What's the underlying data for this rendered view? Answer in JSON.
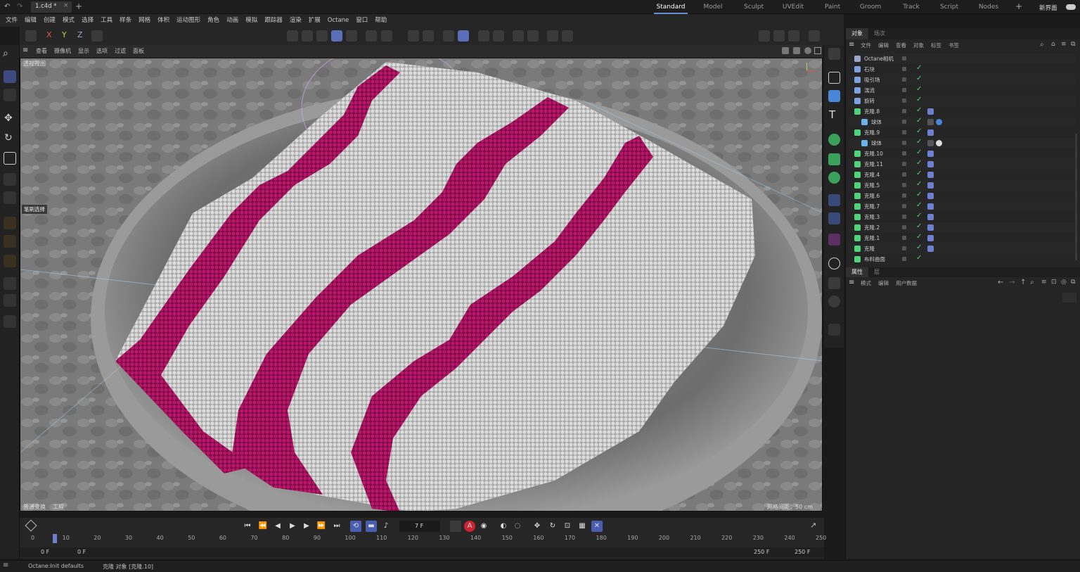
{
  "titlebar": {
    "doc_tab": "1.c4d *",
    "layouts": [
      "Standard",
      "Model",
      "Sculpt",
      "UVEdit",
      "Paint",
      "Groom",
      "Track",
      "Script",
      "Nodes"
    ],
    "active_layout": "Standard",
    "new_layout": "新界面"
  },
  "menu": [
    "文件",
    "编辑",
    "创建",
    "模式",
    "选择",
    "工具",
    "样条",
    "网格",
    "体积",
    "运动图形",
    "角色",
    "动画",
    "模拟",
    "跟踪器",
    "渲染",
    "扩展",
    "Octane",
    "窗口",
    "帮助"
  ],
  "toolbar": {
    "axis_x": "X",
    "axis_y": "Y",
    "axis_z": "Z"
  },
  "viewport": {
    "menu": [
      "查看",
      "摄像机",
      "显示",
      "选项",
      "过滤",
      "面板"
    ],
    "view_name": "透视视图",
    "tool_label": "笔刷选择",
    "transform_label": "普通变换",
    "project_label": "工程",
    "grid_spacing": "网格间距：50 cm"
  },
  "object_panel": {
    "tabs": [
      "对象",
      "场次"
    ],
    "menu": [
      "文件",
      "编辑",
      "查看",
      "对象",
      "标签",
      "书签"
    ],
    "rows": [
      {
        "name": "Octane相机",
        "indent": 0,
        "icon": "camera-icon",
        "color": "#9aa7c9"
      },
      {
        "name": "石块",
        "indent": 0,
        "icon": "figure-icon",
        "color": "#7fa1e0"
      },
      {
        "name": "吸引场",
        "indent": 0,
        "icon": "attractor-icon",
        "color": "#7fa1e0"
      },
      {
        "name": "湍流",
        "indent": 0,
        "icon": "turbulence-icon",
        "color": "#7fa1e0"
      },
      {
        "name": "旋转",
        "indent": 0,
        "icon": "rotate-icon",
        "color": "#7fa1e0"
      },
      {
        "name": "克隆.8",
        "indent": 0,
        "icon": "cloner-icon",
        "color": "#4fd27a"
      },
      {
        "name": "球体",
        "indent": 1,
        "icon": "sphere-icon",
        "color": "#6ab3ea"
      },
      {
        "name": "克隆.9",
        "indent": 0,
        "icon": "cloner-icon",
        "color": "#4fd27a"
      },
      {
        "name": "球体",
        "indent": 1,
        "icon": "sphere-icon",
        "color": "#6ab3ea"
      },
      {
        "name": "克隆.10",
        "indent": 0,
        "icon": "cloner-icon",
        "color": "#4fd27a"
      },
      {
        "name": "克隆.11",
        "indent": 0,
        "icon": "cloner-icon",
        "color": "#4fd27a"
      },
      {
        "name": "克隆.4",
        "indent": 0,
        "icon": "cloner-icon",
        "color": "#4fd27a"
      },
      {
        "name": "克隆.5",
        "indent": 0,
        "icon": "cloner-icon",
        "color": "#4fd27a"
      },
      {
        "name": "克隆.6",
        "indent": 0,
        "icon": "cloner-icon",
        "color": "#4fd27a"
      },
      {
        "name": "克隆.7",
        "indent": 0,
        "icon": "cloner-icon",
        "color": "#4fd27a"
      },
      {
        "name": "克隆.3",
        "indent": 0,
        "icon": "cloner-icon",
        "color": "#4fd27a"
      },
      {
        "name": "克隆.2",
        "indent": 0,
        "icon": "cloner-icon",
        "color": "#4fd27a"
      },
      {
        "name": "克隆.1",
        "indent": 0,
        "icon": "cloner-icon",
        "color": "#4fd27a"
      },
      {
        "name": "克隆",
        "indent": 0,
        "icon": "cloner-icon",
        "color": "#4fd27a"
      },
      {
        "name": "布料曲面",
        "indent": 0,
        "icon": "cloth-surface-icon",
        "color": "#4fd27a"
      }
    ]
  },
  "attr_panel": {
    "tabs": [
      "属性",
      "层"
    ],
    "menu": [
      "模式",
      "编辑",
      "用户数据"
    ]
  },
  "timeline": {
    "current_frame": "7 F",
    "ticks": [
      "0",
      "10",
      "20",
      "30",
      "40",
      "50",
      "60",
      "70",
      "80",
      "90",
      "100",
      "110",
      "120",
      "130",
      "140",
      "150",
      "160",
      "170",
      "180",
      "190",
      "200",
      "210",
      "220",
      "230",
      "240",
      "250"
    ],
    "start_a": "0 F",
    "start_b": "0 F",
    "end_a": "250 F",
    "end_b": "250 F",
    "playhead": 7,
    "max": 250
  },
  "status": {
    "renderer": "Octane:Init defaults",
    "message": "克隆 对象 [克隆.10]"
  },
  "colors": {
    "accent": "#5a6fb8",
    "stripe": "#b0155e",
    "cloth": "#cfcfcf",
    "check": "#4fd27a"
  }
}
